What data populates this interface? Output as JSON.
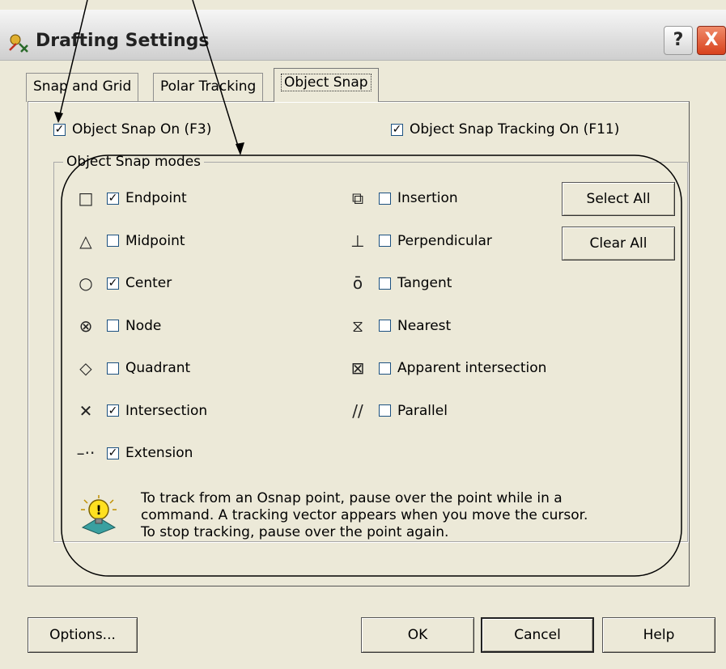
{
  "window": {
    "title": "Drafting Settings",
    "help_label": "?",
    "close_label": "X",
    "colors": {
      "face": "#ece9d8",
      "close_red": "#d8411c"
    }
  },
  "tabs": [
    {
      "label": "Snap and Grid",
      "selected": false
    },
    {
      "label": "Polar Tracking",
      "selected": false
    },
    {
      "label": "Object Snap",
      "selected": true
    }
  ],
  "top_options": {
    "osnap_on": {
      "label": "Object Snap On (F3)",
      "checked": true
    },
    "osnap_tracking_on": {
      "label": "Object Snap Tracking On (F11)",
      "checked": true
    }
  },
  "modes": {
    "group_label": "Object Snap modes",
    "left": [
      {
        "symbol": "square-marker-icon",
        "glyph": "□",
        "label": "Endpoint",
        "checked": true
      },
      {
        "symbol": "triangle-marker-icon",
        "glyph": "△",
        "label": "Midpoint",
        "checked": false
      },
      {
        "symbol": "circle-marker-icon",
        "glyph": "○",
        "label": "Center",
        "checked": true
      },
      {
        "symbol": "circle-x-marker-icon",
        "glyph": "⊗",
        "label": "Node",
        "checked": false
      },
      {
        "symbol": "diamond-marker-icon",
        "glyph": "◇",
        "label": "Quadrant",
        "checked": false
      },
      {
        "symbol": "x-marker-icon",
        "glyph": "✕",
        "label": "Intersection",
        "checked": true
      },
      {
        "symbol": "extension-marker-icon",
        "glyph": "–··",
        "label": "Extension",
        "checked": true
      }
    ],
    "right": [
      {
        "symbol": "insertion-marker-icon",
        "glyph": "⧉",
        "label": "Insertion",
        "checked": false
      },
      {
        "symbol": "perpendicular-marker-icon",
        "glyph": "⊥",
        "label": "Perpendicular",
        "checked": false
      },
      {
        "symbol": "tangent-marker-icon",
        "glyph": "ō",
        "label": "Tangent",
        "checked": false
      },
      {
        "symbol": "hourglass-marker-icon",
        "glyph": "⧖",
        "label": "Nearest",
        "checked": false
      },
      {
        "symbol": "boxed-x-marker-icon",
        "glyph": "⊠",
        "label": "Apparent intersection",
        "checked": false
      },
      {
        "symbol": "parallel-marker-icon",
        "glyph": "//",
        "label": "Parallel",
        "checked": false
      }
    ],
    "select_all": "Select All",
    "clear_all": "Clear All"
  },
  "tip": {
    "icon": "lightbulb-icon",
    "lines": [
      "To track from an Osnap point, pause over the point while in a",
      "command.  A tracking vector appears when you move the cursor.",
      "To stop tracking, pause over the point again."
    ]
  },
  "footer": {
    "options": "Options...",
    "ok": "OK",
    "cancel": "Cancel",
    "help": "Help"
  }
}
